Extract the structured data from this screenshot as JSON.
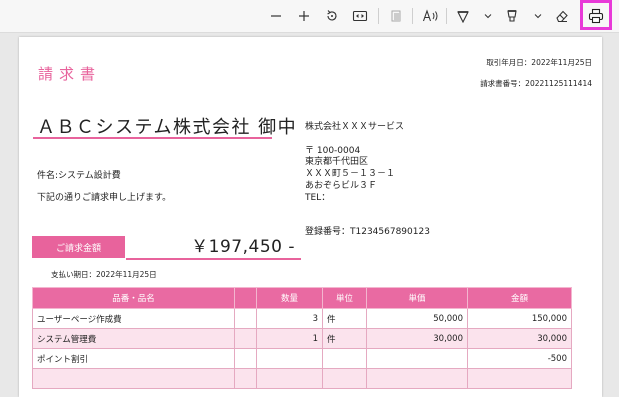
{
  "toolbar": {
    "items": [
      {
        "name": "zoom-out-icon",
        "interactable": true
      },
      {
        "name": "zoom-in-icon",
        "interactable": true
      },
      {
        "name": "rotate-icon",
        "interactable": true
      },
      {
        "name": "fit-page-icon",
        "interactable": true
      },
      {
        "name": "page-view-icon",
        "interactable": false
      },
      {
        "name": "read-aloud-icon",
        "interactable": true
      },
      {
        "name": "draw-icon",
        "interactable": true
      },
      {
        "name": "highlight-icon",
        "interactable": true
      },
      {
        "name": "eraser-icon",
        "interactable": true
      },
      {
        "name": "print-icon",
        "interactable": true
      }
    ],
    "highlight_color": "#e83ad8"
  },
  "document": {
    "title": "請求書",
    "billing_date": "取引年月日：2022年11月25日",
    "invoice_number": "請求書番号：20221125111414",
    "customer": "ＡＢＣシステム株式会社 御中",
    "subject": "件名:システム設計費",
    "greeting": "下記の通りご請求申し上げます。",
    "issuer": {
      "company": "株式会社ＸＸＸサービス",
      "postal": "〒 100-0004",
      "address1": "東京都千代田区",
      "address2": "ＸＸＸ町５－１３－１",
      "address3": "あおぞらビル３Ｆ",
      "tel": "TEL：",
      "registration": "登録番号：T1234567890123"
    },
    "amount_label": "ご請求金額",
    "amount_value": "￥197,450 -",
    "due_date": "支払い期日：2022年11月25日",
    "accent_color": "#e8639c"
  },
  "table": {
    "headers": [
      "品番・品名",
      "",
      "数量",
      "単位",
      "単価",
      "金額"
    ],
    "rows": [
      {
        "name": "ユーザーページ作成費",
        "code": "",
        "qty": "3",
        "unit": "件",
        "price": "50,000",
        "amount": "150,000"
      },
      {
        "name": "システム管理費",
        "code": "",
        "qty": "1",
        "unit": "件",
        "price": "30,000",
        "amount": "30,000"
      },
      {
        "name": "ポイント割引",
        "code": "",
        "qty": "",
        "unit": "",
        "price": "",
        "amount": "-500"
      },
      {
        "name": "",
        "code": "",
        "qty": "",
        "unit": "",
        "price": "",
        "amount": ""
      }
    ]
  }
}
